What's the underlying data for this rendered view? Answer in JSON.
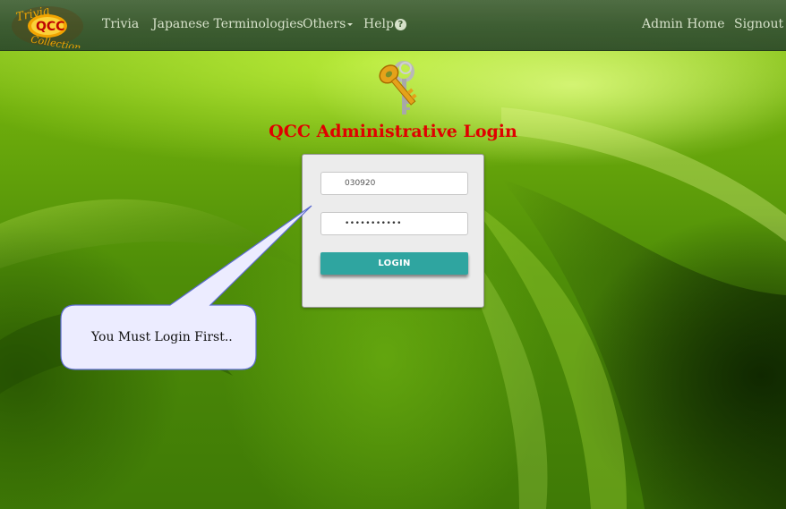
{
  "navbar": {
    "logo": {
      "line1": "Trivia",
      "center": "QCC",
      "line2": "Collection"
    },
    "items": [
      {
        "label": "Trivia"
      },
      {
        "label": "Japanese Terminologies"
      },
      {
        "label": "Others"
      },
      {
        "label": "Help"
      }
    ],
    "right_items": [
      {
        "label": "Admin Home"
      },
      {
        "label": "Signout"
      }
    ]
  },
  "login": {
    "title": "QCC Administrative Login",
    "username_value": "030920",
    "password_value": "•••••••••••",
    "button_label": "LOGIN"
  },
  "callout": {
    "text": "You Must Login First.."
  },
  "colors": {
    "title_red": "#e00000",
    "button_teal": "#2fa5a0",
    "navbar": "#3b5a33"
  }
}
